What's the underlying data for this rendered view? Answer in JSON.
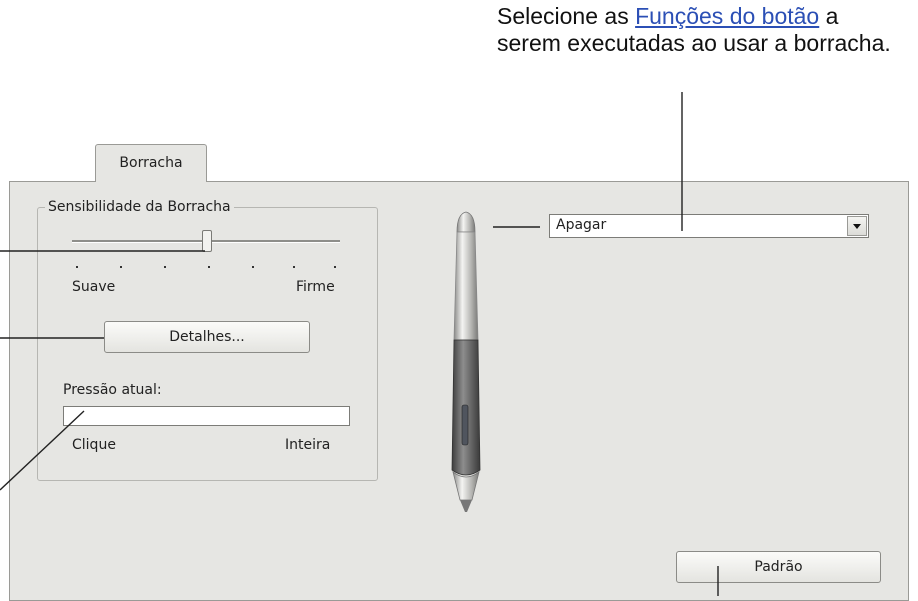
{
  "callout": {
    "prefix": "Selecione as ",
    "link": "Funções do botão",
    "suffix": " a serem executadas ao usar a borracha."
  },
  "tab": {
    "label": "Borracha"
  },
  "sensitivity": {
    "group_label": "Sensibilidade da Borracha",
    "min_label": "Suave",
    "max_label": "Firme",
    "level_fraction": 0.5
  },
  "details_button": {
    "label": "Detalhes..."
  },
  "pressure": {
    "label": "Pressão atual:",
    "min_label": "Clique",
    "max_label": "Inteira",
    "level_fraction": 0
  },
  "eraser_function": {
    "selected": "Apagar"
  },
  "default_button": {
    "label": "Padrão"
  },
  "colors": {
    "panel": "#e6e6e3",
    "link": "#2b4fb5"
  }
}
